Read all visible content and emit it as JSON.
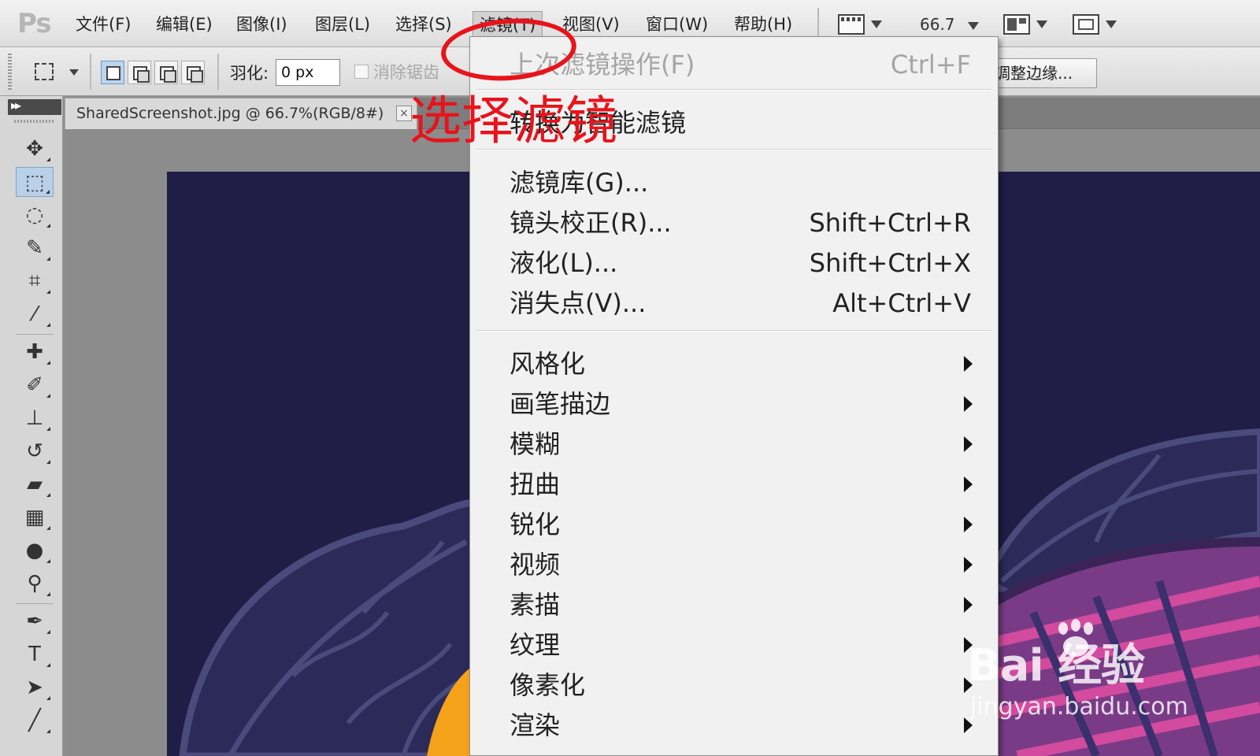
{
  "app": {
    "logo": "Ps"
  },
  "menubar": {
    "items": [
      {
        "label": "文件(F)"
      },
      {
        "label": "编辑(E)"
      },
      {
        "label": "图像(I)"
      },
      {
        "label": "图层(L)"
      },
      {
        "label": "选择(S)"
      },
      {
        "label": "滤镜(T)",
        "active": true
      },
      {
        "label": "视图(V)"
      },
      {
        "label": "窗口(W)"
      },
      {
        "label": "帮助(H)"
      }
    ],
    "zoom": "66.7"
  },
  "options": {
    "feather_label": "羽化:",
    "feather_value": "0 px",
    "antialias_label": "消除锯齿",
    "refine_edge_label": "调整边缘..."
  },
  "document": {
    "tab_title": "SharedScreenshot.jpg @ 66.7%(RGB/8#)",
    "close_glyph": "×"
  },
  "filter_menu": {
    "items": [
      {
        "label": "上次滤镜操作(F)",
        "shortcut": "Ctrl+F",
        "disabled": true
      },
      {
        "label": "转换为智能滤镜",
        "shortcut": ""
      },
      {
        "label": "滤镜库(G)...",
        "shortcut": ""
      },
      {
        "label": "镜头校正(R)...",
        "shortcut": "Shift+Ctrl+R"
      },
      {
        "label": "液化(L)...",
        "shortcut": "Shift+Ctrl+X"
      },
      {
        "label": "消失点(V)...",
        "shortcut": "Alt+Ctrl+V"
      },
      {
        "label": "风格化",
        "submenu": true
      },
      {
        "label": "画笔描边",
        "submenu": true
      },
      {
        "label": "模糊",
        "submenu": true
      },
      {
        "label": "扭曲",
        "submenu": true
      },
      {
        "label": "锐化",
        "submenu": true
      },
      {
        "label": "视频",
        "submenu": true
      },
      {
        "label": "素描",
        "submenu": true
      },
      {
        "label": "纹理",
        "submenu": true
      },
      {
        "label": "像素化",
        "submenu": true
      },
      {
        "label": "渲染",
        "submenu": true
      }
    ]
  },
  "annotation": {
    "text": "选择滤镜",
    "color": "#e8131b"
  },
  "watermark": {
    "brand": "Bai  经验",
    "url": "jingyan.baidu.com"
  },
  "colors": {
    "artwork_bg": "#201d46",
    "menu_bg": "#f1f1f1"
  }
}
